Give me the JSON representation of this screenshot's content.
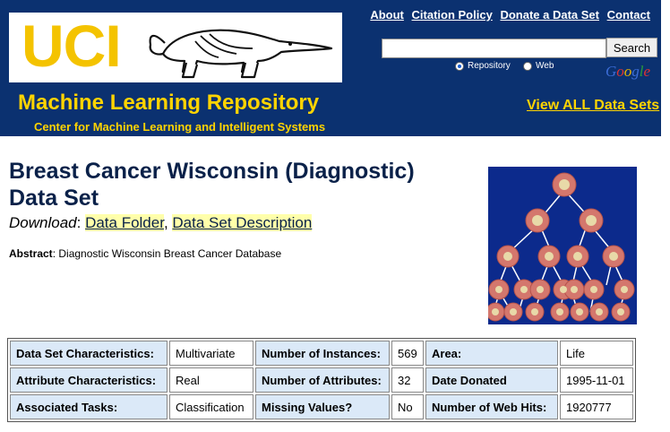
{
  "header": {
    "logo": "UCI",
    "title": "Machine Learning Repository",
    "subtitle": "Center for Machine Learning and Intelligent Systems",
    "links": [
      "About",
      "Citation Policy",
      "Donate a Data Set",
      "Contact"
    ],
    "search_button": "Search",
    "search_value": "",
    "radio_options": [
      {
        "label": "Repository",
        "selected": true
      },
      {
        "label": "Web",
        "selected": false
      }
    ],
    "google_label": "Google",
    "view_all": "View ALL Data Sets"
  },
  "dataset": {
    "title_line1": "Breast Cancer Wisconsin (Diagnostic)",
    "title_line2": "Data Set",
    "download_label": "Download",
    "download_links": [
      "Data Folder",
      "Data Set Description"
    ],
    "abstract_label": "Abstract",
    "abstract_text": "Diagnostic Wisconsin Breast Cancer Database"
  },
  "info_table": [
    [
      "Data Set Characteristics:",
      "Multivariate",
      "Number of Instances:",
      "569",
      "Area:",
      "Life"
    ],
    [
      "Attribute Characteristics:",
      "Real",
      "Number of Attributes:",
      "32",
      "Date Donated",
      "1995-11-01"
    ],
    [
      "Associated Tasks:",
      "Classification",
      "Missing Values?",
      "No",
      "Number of Web Hits:",
      "1920777"
    ]
  ],
  "colors": {
    "header_bg": "#0b3170",
    "accent_yellow": "#ffd400",
    "title_navy": "#0a2149",
    "link_highlight": "#ffffaa",
    "table_key_bg": "#dbe9f8"
  }
}
